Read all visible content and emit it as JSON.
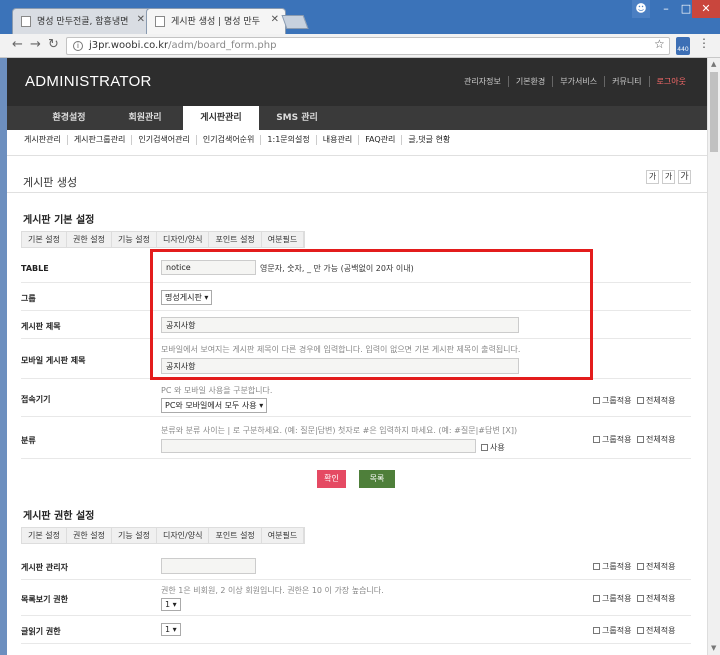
{
  "browser": {
    "tabs": [
      {
        "title": "명성 만두전골, 함흥냉면"
      },
      {
        "title": "게시판 생성 | 명성 만두"
      }
    ],
    "url_host": "j3pr.woobi.co.kr",
    "url_path": "/adm/board_form.php",
    "extension_badge": "440"
  },
  "admin": {
    "brand": "ADMINISTRATOR",
    "top_links": [
      "관리자정보",
      "기본환경",
      "부가서비스",
      "커뮤니티",
      "로그아웃"
    ],
    "main_nav": [
      "환경설정",
      "회원관리",
      "게시판관리",
      "SMS 관리"
    ],
    "main_nav_active": 2,
    "sub_nav": [
      "게시판관리",
      "게시판그룹관리",
      "인기검색어관리",
      "인기검색어순위",
      "1:1문의설정",
      "내용관리",
      "FAQ관리",
      "글,댓글 현황"
    ]
  },
  "page": {
    "title": "게시판 생성",
    "font_buttons": [
      "가",
      "가",
      "가"
    ]
  },
  "basic_settings": {
    "title": "게시판 기본 설정",
    "tabs": [
      "기본 설정",
      "권한 설정",
      "기능 설정",
      "디자인/양식",
      "포인트 설정",
      "여분필드"
    ],
    "table_label": "TABLE",
    "table_value": "notice",
    "table_help": "영문자, 숫자, _ 만 가능 (공백없이 20자 이내)",
    "group_label": "그룹",
    "group_value": "명성게시판",
    "subject_label": "게시판 제목",
    "subject_value": "공지사항",
    "mobile_subject_label": "모바일 게시판 제목",
    "mobile_subject_help": "모바일에서 보여지는 게시판 제목이 다른 경우에 입력합니다. 입력이 없으면 기본 게시판 제목이 출력됩니다.",
    "mobile_subject_value": "공지사항",
    "device_label": "접속기기",
    "device_help": "PC 와 모바일 사용을 구분합니다.",
    "device_value": "PC와 모바일에서 모두 사용",
    "category_label": "분류",
    "category_help": "분류와 분류 사이는 | 로 구분하세요. (예: 질문|답변) 첫자로 #은 입력하지 마세요. (예: #질문|#답변 [X])",
    "category_use": "사용",
    "apply_group": "그룹적용",
    "apply_all": "전체적용"
  },
  "buttons": {
    "ok": "확인",
    "list": "목록"
  },
  "permission_settings": {
    "title": "게시판 권한 설정",
    "tabs": [
      "기본 설정",
      "권한 설정",
      "기능 설정",
      "디자인/양식",
      "포인트 설정",
      "여분필드"
    ],
    "admin_label": "게시판 관리자",
    "admin_value": "",
    "list_level_label": "목록보기 권한",
    "level_help": "권한 1은 비회원, 2 이상 회원입니다. 권한은 10 이 가장 높습니다.",
    "list_level_value": "1",
    "read_level_label": "글읽기 권한",
    "read_level_value": "1"
  }
}
